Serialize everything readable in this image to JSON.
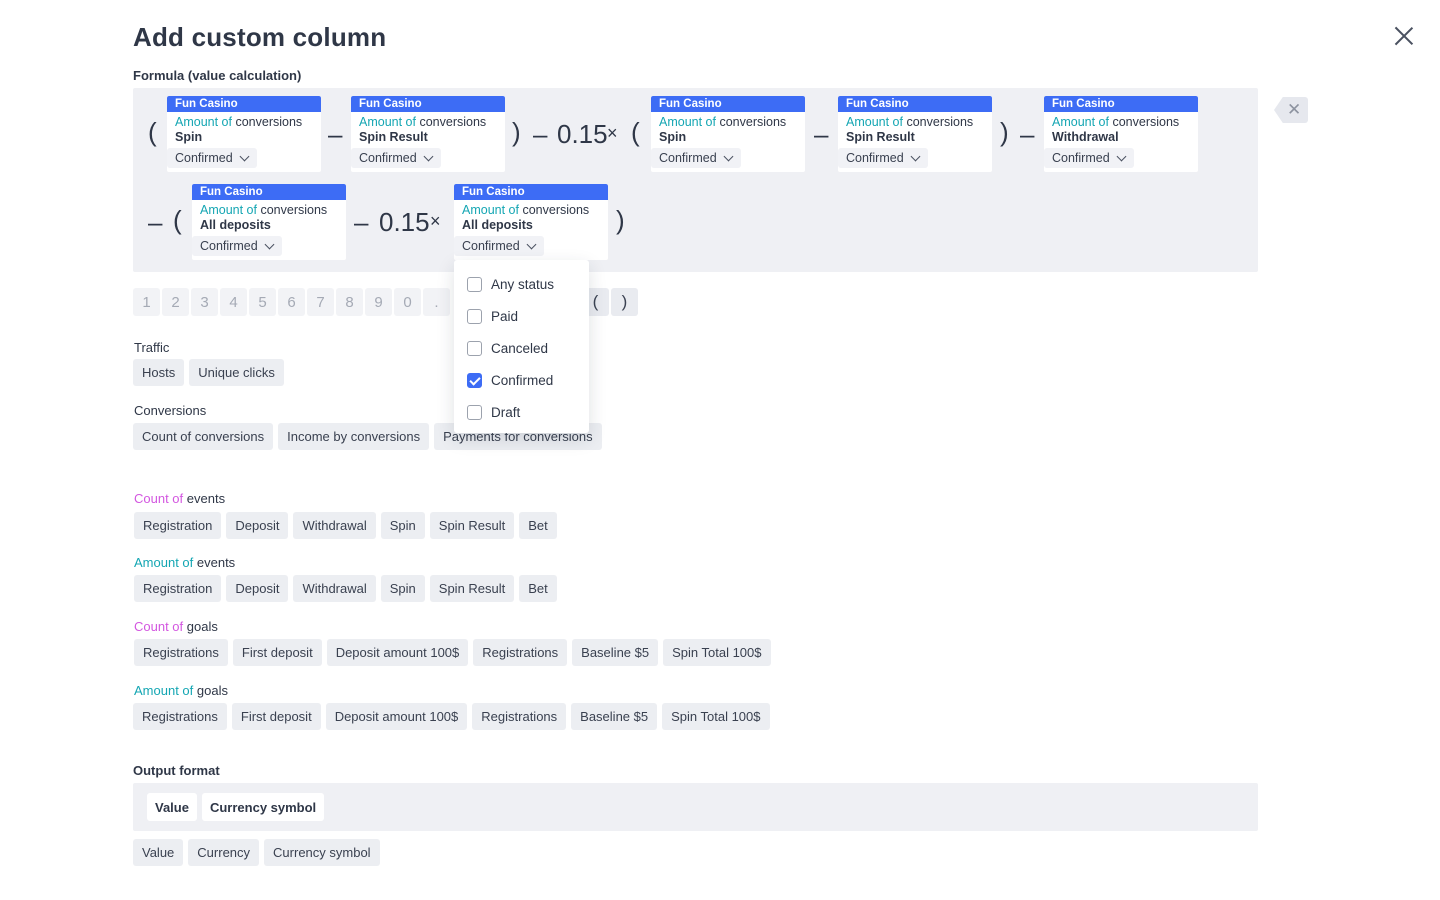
{
  "title": "Add custom column",
  "formula_label": "Formula (value calculation)",
  "formula": {
    "cards": [
      {
        "source": "Fun Casino",
        "metric_accent": "Amount of",
        "metric_rest": " conversions",
        "event": "Spin",
        "status": "Confirmed"
      },
      {
        "source": "Fun Casino",
        "metric_accent": "Amount of",
        "metric_rest": " conversions",
        "event": "Spin Result",
        "status": "Confirmed"
      },
      {
        "source": "Fun Casino",
        "metric_accent": "Amount of",
        "metric_rest": " conversions",
        "event": "Spin",
        "status": "Confirmed"
      },
      {
        "source": "Fun Casino",
        "metric_accent": "Amount of",
        "metric_rest": " conversions",
        "event": "Spin Result",
        "status": "Confirmed"
      },
      {
        "source": "Fun Casino",
        "metric_accent": "Amount of",
        "metric_rest": " conversions",
        "event": "Withdrawal",
        "status": "Confirmed"
      },
      {
        "source": "Fun Casino",
        "metric_accent": "Amount of",
        "metric_rest": " conversions",
        "event": "All deposits",
        "status": "Confirmed"
      },
      {
        "source": "Fun Casino",
        "metric_accent": "Amount of",
        "metric_rest": " conversions",
        "event": "All deposits",
        "status": "Confirmed"
      }
    ],
    "operators": {
      "open1": "(",
      "minus1": "–",
      "close1": ")",
      "minus2": "–",
      "num1": "0.15",
      "times1": "×",
      "open2": "(",
      "minus3": "–",
      "close2": ")",
      "minus4": "–",
      "minus5": "–",
      "open3": "(",
      "minus6": "–",
      "num2": "0.15",
      "times2": "×",
      "close3": ")"
    },
    "clear_glyph": "✕"
  },
  "keypad": {
    "digits": [
      "1",
      "2",
      "3",
      "4",
      "5",
      "6",
      "7",
      "8",
      "9",
      "0",
      "."
    ],
    "parens": [
      "(",
      ")"
    ]
  },
  "status_dropdown": {
    "options": [
      {
        "label": "Any status",
        "checked": false
      },
      {
        "label": "Paid",
        "checked": false
      },
      {
        "label": "Canceled",
        "checked": false
      },
      {
        "label": "Confirmed",
        "checked": true
      },
      {
        "label": "Draft",
        "checked": false
      }
    ]
  },
  "traffic": {
    "label": "Traffic",
    "items": [
      "Hosts",
      "Unique clicks"
    ]
  },
  "conversions": {
    "label": "Conversions",
    "items": [
      "Count of conversions",
      "Income by conversions",
      "Payments for conversions"
    ]
  },
  "count_events": {
    "accent": "Count of",
    "rest": " events",
    "items": [
      "Registration",
      "Deposit",
      "Withdrawal",
      "Spin",
      "Spin Result",
      "Bet"
    ]
  },
  "amount_events": {
    "accent": "Amount of",
    "rest": " events",
    "items": [
      "Registration",
      "Deposit",
      "Withdrawal",
      "Spin",
      "Spin Result",
      "Bet"
    ]
  },
  "count_goals": {
    "accent": "Count of",
    "rest": " goals",
    "items": [
      "Registrations",
      "First deposit",
      "Deposit amount 100$",
      "Registrations",
      "Baseline $5",
      "Spin Total 100$"
    ]
  },
  "amount_goals": {
    "accent": "Amount of",
    "rest": " goals",
    "items": [
      "Registrations",
      "First deposit",
      "Deposit amount 100$",
      "Registrations",
      "Baseline $5",
      "Spin Total 100$"
    ]
  },
  "output": {
    "label": "Output format",
    "selected": [
      "Value",
      "Currency symbol"
    ],
    "options": [
      "Value",
      "Currency",
      "Currency symbol"
    ]
  },
  "colors": {
    "accent_blue": "#3d6cf5",
    "accent_teal": "#14a6b3",
    "accent_pink": "#d357e0"
  }
}
